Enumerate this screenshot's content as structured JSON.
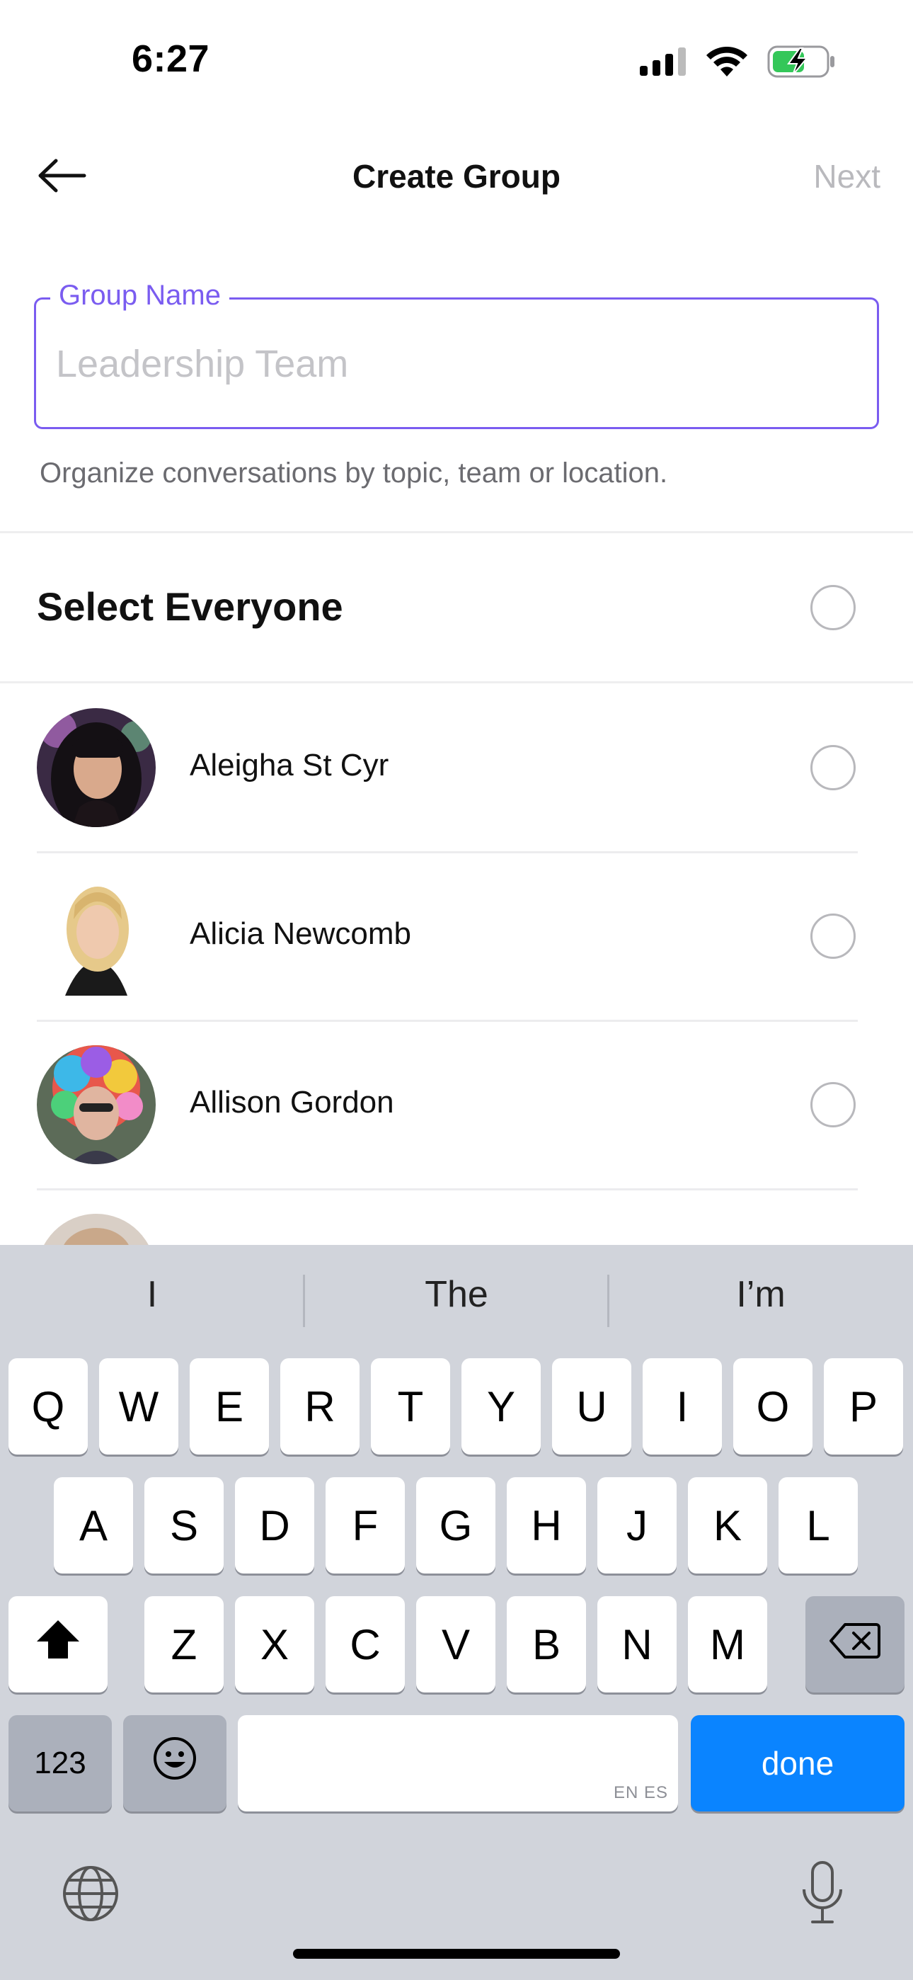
{
  "status_bar": {
    "time": "6:27",
    "icons": [
      "cellular-signal-icon",
      "wifi-icon",
      "battery-charging-icon"
    ],
    "battery_color": "#34c759"
  },
  "nav": {
    "back_icon": "back-arrow-icon",
    "title": "Create Group",
    "next_label": "Next"
  },
  "group_name": {
    "label": "Group Name",
    "placeholder": "Leadership Team",
    "value": "",
    "helper": "Organize conversations by topic, team or location.",
    "accent_color": "#7a5cf0"
  },
  "select_everyone": {
    "label": "Select Everyone",
    "selected": false
  },
  "members": [
    {
      "name": "Aleigha St Cyr",
      "selected": false
    },
    {
      "name": "Alicia Newcomb",
      "selected": false
    },
    {
      "name": "Allison Gordon",
      "selected": false
    }
  ],
  "keyboard": {
    "suggestions": [
      "I",
      "The",
      "I’m"
    ],
    "row1": [
      "Q",
      "W",
      "E",
      "R",
      "T",
      "Y",
      "U",
      "I",
      "O",
      "P"
    ],
    "row2": [
      "A",
      "S",
      "D",
      "F",
      "G",
      "H",
      "J",
      "K",
      "L"
    ],
    "row3": [
      "Z",
      "X",
      "C",
      "V",
      "B",
      "N",
      "M"
    ],
    "shift_icon": "shift-icon",
    "delete_icon": "delete-icon",
    "numbers_label": "123",
    "emoji_icon": "emoji-icon",
    "space_hint": "EN ES",
    "done_label": "done",
    "globe_icon": "globe-icon",
    "mic_icon": "microphone-icon",
    "done_color": "#0a84ff"
  }
}
